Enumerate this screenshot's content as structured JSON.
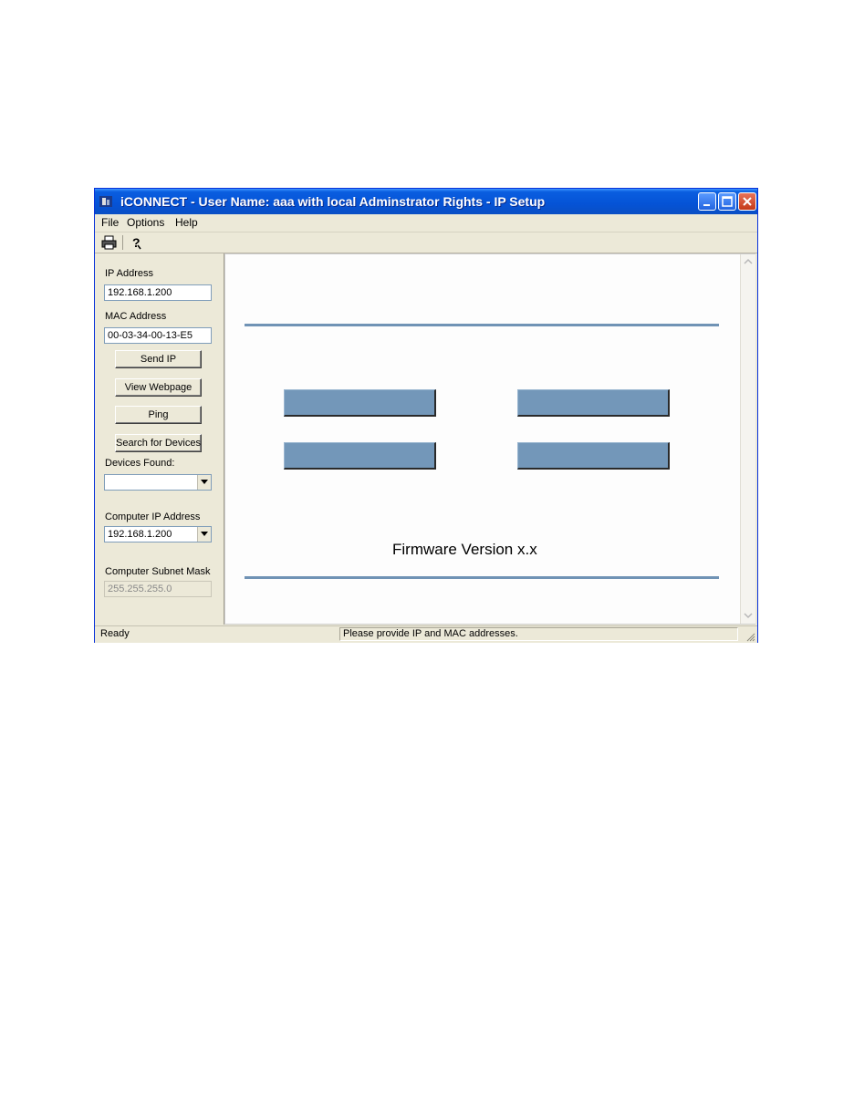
{
  "window": {
    "title": "iCONNECT - User Name: aaa with local Adminstrator Rights - IP Setup",
    "icon": "app-icon",
    "controls": [
      "minimize-icon",
      "maximize-icon",
      "close-icon"
    ]
  },
  "menu": {
    "file": "File",
    "options": "Options",
    "help": "Help"
  },
  "toolbar": {
    "items": [
      "print-icon",
      "help-icon"
    ]
  },
  "left": {
    "ip_label": "IP Address",
    "ip_value": "192.168.1.200",
    "mac_label": "MAC Address",
    "mac_value": "00-03-34-00-13-E5",
    "send_ip": "Send IP",
    "view_webpage": "View Webpage",
    "ping": "Ping",
    "search_devices": "Search for Devices",
    "devices_label": "Devices Found:",
    "devices_value": "",
    "computer_ip_label": "Computer IP Address",
    "computer_ip_value": "192.168.1.200",
    "subnet_label": "Computer Subnet Mask",
    "subnet_value": "255.255.255.0"
  },
  "content": {
    "firmware": "Firmware Version x.x",
    "button_color": "#7397b9",
    "rule_color": "#7093b5"
  },
  "status": {
    "left": "Ready",
    "right": "Please provide IP and MAC addresses."
  }
}
